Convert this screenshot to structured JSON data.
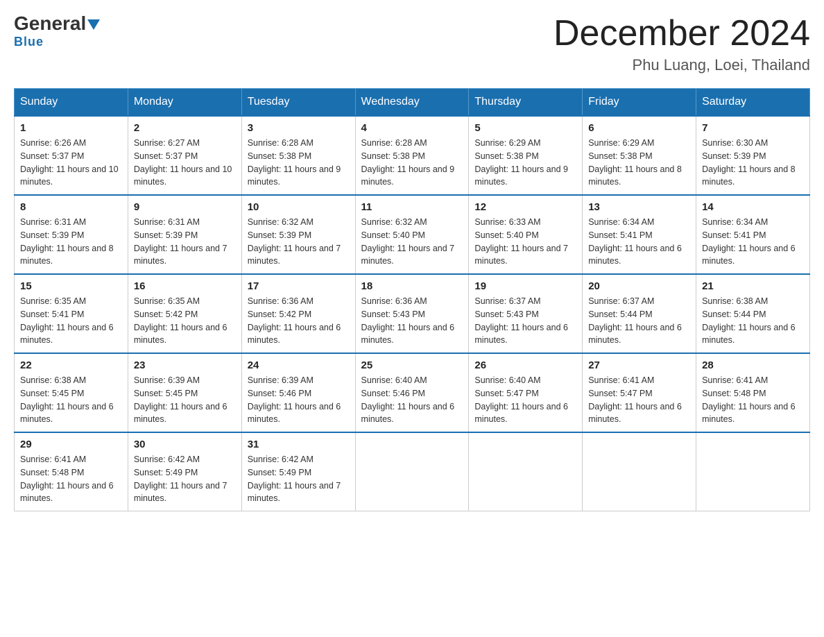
{
  "header": {
    "logo_general": "General",
    "logo_blue": "Blue",
    "main_title": "December 2024",
    "subtitle": "Phu Luang, Loei, Thailand"
  },
  "weekdays": [
    "Sunday",
    "Monday",
    "Tuesday",
    "Wednesday",
    "Thursday",
    "Friday",
    "Saturday"
  ],
  "weeks": [
    [
      {
        "day": "1",
        "sunrise": "6:26 AM",
        "sunset": "5:37 PM",
        "daylight": "11 hours and 10 minutes."
      },
      {
        "day": "2",
        "sunrise": "6:27 AM",
        "sunset": "5:37 PM",
        "daylight": "11 hours and 10 minutes."
      },
      {
        "day": "3",
        "sunrise": "6:28 AM",
        "sunset": "5:38 PM",
        "daylight": "11 hours and 9 minutes."
      },
      {
        "day": "4",
        "sunrise": "6:28 AM",
        "sunset": "5:38 PM",
        "daylight": "11 hours and 9 minutes."
      },
      {
        "day": "5",
        "sunrise": "6:29 AM",
        "sunset": "5:38 PM",
        "daylight": "11 hours and 9 minutes."
      },
      {
        "day": "6",
        "sunrise": "6:29 AM",
        "sunset": "5:38 PM",
        "daylight": "11 hours and 8 minutes."
      },
      {
        "day": "7",
        "sunrise": "6:30 AM",
        "sunset": "5:39 PM",
        "daylight": "11 hours and 8 minutes."
      }
    ],
    [
      {
        "day": "8",
        "sunrise": "6:31 AM",
        "sunset": "5:39 PM",
        "daylight": "11 hours and 8 minutes."
      },
      {
        "day": "9",
        "sunrise": "6:31 AM",
        "sunset": "5:39 PM",
        "daylight": "11 hours and 7 minutes."
      },
      {
        "day": "10",
        "sunrise": "6:32 AM",
        "sunset": "5:39 PM",
        "daylight": "11 hours and 7 minutes."
      },
      {
        "day": "11",
        "sunrise": "6:32 AM",
        "sunset": "5:40 PM",
        "daylight": "11 hours and 7 minutes."
      },
      {
        "day": "12",
        "sunrise": "6:33 AM",
        "sunset": "5:40 PM",
        "daylight": "11 hours and 7 minutes."
      },
      {
        "day": "13",
        "sunrise": "6:34 AM",
        "sunset": "5:41 PM",
        "daylight": "11 hours and 6 minutes."
      },
      {
        "day": "14",
        "sunrise": "6:34 AM",
        "sunset": "5:41 PM",
        "daylight": "11 hours and 6 minutes."
      }
    ],
    [
      {
        "day": "15",
        "sunrise": "6:35 AM",
        "sunset": "5:41 PM",
        "daylight": "11 hours and 6 minutes."
      },
      {
        "day": "16",
        "sunrise": "6:35 AM",
        "sunset": "5:42 PM",
        "daylight": "11 hours and 6 minutes."
      },
      {
        "day": "17",
        "sunrise": "6:36 AM",
        "sunset": "5:42 PM",
        "daylight": "11 hours and 6 minutes."
      },
      {
        "day": "18",
        "sunrise": "6:36 AM",
        "sunset": "5:43 PM",
        "daylight": "11 hours and 6 minutes."
      },
      {
        "day": "19",
        "sunrise": "6:37 AM",
        "sunset": "5:43 PM",
        "daylight": "11 hours and 6 minutes."
      },
      {
        "day": "20",
        "sunrise": "6:37 AM",
        "sunset": "5:44 PM",
        "daylight": "11 hours and 6 minutes."
      },
      {
        "day": "21",
        "sunrise": "6:38 AM",
        "sunset": "5:44 PM",
        "daylight": "11 hours and 6 minutes."
      }
    ],
    [
      {
        "day": "22",
        "sunrise": "6:38 AM",
        "sunset": "5:45 PM",
        "daylight": "11 hours and 6 minutes."
      },
      {
        "day": "23",
        "sunrise": "6:39 AM",
        "sunset": "5:45 PM",
        "daylight": "11 hours and 6 minutes."
      },
      {
        "day": "24",
        "sunrise": "6:39 AM",
        "sunset": "5:46 PM",
        "daylight": "11 hours and 6 minutes."
      },
      {
        "day": "25",
        "sunrise": "6:40 AM",
        "sunset": "5:46 PM",
        "daylight": "11 hours and 6 minutes."
      },
      {
        "day": "26",
        "sunrise": "6:40 AM",
        "sunset": "5:47 PM",
        "daylight": "11 hours and 6 minutes."
      },
      {
        "day": "27",
        "sunrise": "6:41 AM",
        "sunset": "5:47 PM",
        "daylight": "11 hours and 6 minutes."
      },
      {
        "day": "28",
        "sunrise": "6:41 AM",
        "sunset": "5:48 PM",
        "daylight": "11 hours and 6 minutes."
      }
    ],
    [
      {
        "day": "29",
        "sunrise": "6:41 AM",
        "sunset": "5:48 PM",
        "daylight": "11 hours and 6 minutes."
      },
      {
        "day": "30",
        "sunrise": "6:42 AM",
        "sunset": "5:49 PM",
        "daylight": "11 hours and 7 minutes."
      },
      {
        "day": "31",
        "sunrise": "6:42 AM",
        "sunset": "5:49 PM",
        "daylight": "11 hours and 7 minutes."
      },
      null,
      null,
      null,
      null
    ]
  ]
}
